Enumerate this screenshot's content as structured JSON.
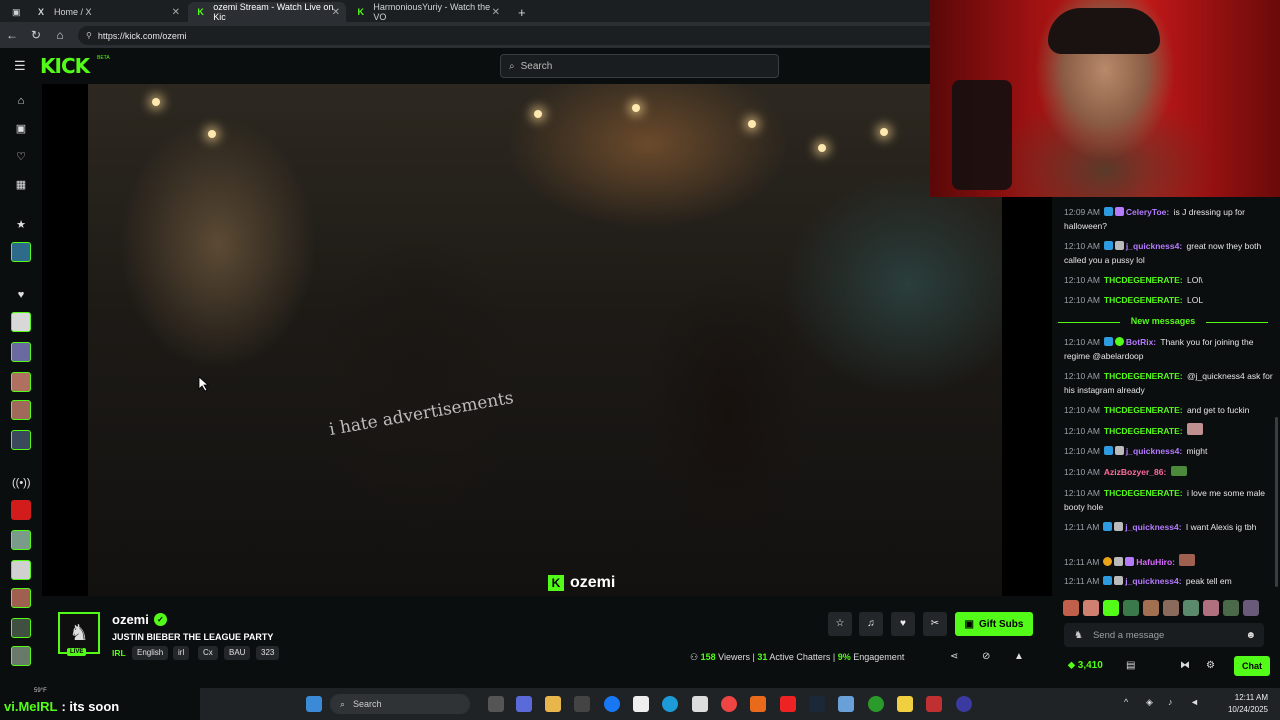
{
  "browser": {
    "tabs": [
      {
        "label": "Home / X",
        "icon": "x-logo-icon"
      },
      {
        "label": "ozemi Stream - Watch Live on Kic",
        "icon": "kick-logo-icon"
      },
      {
        "label": "HarmoniousYuriy - Watch the VO",
        "icon": "kick-logo-icon"
      }
    ],
    "new_tab": "+",
    "url": "https://kick.com/ozemi"
  },
  "header": {
    "logo": "KICK",
    "beta": "BETA",
    "search_placeholder": "Search"
  },
  "video": {
    "watermark": "ozemi",
    "shirt_text": "i hate advertisements"
  },
  "chat": {
    "messages": [
      {
        "time": "12:09 AM",
        "user": "CeleryToe:",
        "text": "is J dressing up for halloween?",
        "color": "#b57bff"
      },
      {
        "time": "12:10 AM",
        "user": "j_quickness4:",
        "text": "great now they both called you a pussy lol",
        "color": "#b57bff"
      },
      {
        "time": "12:10 AM",
        "user": "THCDEGENERATE:",
        "text": "LOl\\",
        "color": "#53fc18"
      },
      {
        "time": "12:10 AM",
        "user": "THCDEGENERATE:",
        "text": "LOL",
        "color": "#53fc18"
      },
      {
        "time": "12:10 AM",
        "user": "BotRix:",
        "text": "Thank you for joining the regime @abelardoop",
        "color": "#b57bff"
      },
      {
        "time": "12:10 AM",
        "user": "THCDEGENERATE:",
        "text": "@j_quickness4 ask for his instagram already",
        "color": "#53fc18"
      },
      {
        "time": "12:10 AM",
        "user": "THCDEGENERATE:",
        "text": "and get to fuckin",
        "color": "#53fc18"
      },
      {
        "time": "12:10 AM",
        "user": "THCDEGENERATE:",
        "text": "",
        "color": "#53fc18"
      },
      {
        "time": "12:10 AM",
        "user": "j_quickness4:",
        "text": "might",
        "color": "#b57bff"
      },
      {
        "time": "12:10 AM",
        "user": "AzizBozyer_86:",
        "text": "",
        "color": "#ff6b9a"
      },
      {
        "time": "12:10 AM",
        "user": "THCDEGENERATE:",
        "text": "i love me some male booty hole",
        "color": "#53fc18"
      },
      {
        "time": "12:11 AM",
        "user": "j_quickness4:",
        "text": "I want Alexis ig tbh",
        "color": "#b57bff"
      },
      {
        "time": "12:11 AM",
        "user": "HafuHiro:",
        "text": "",
        "color": "#d86bff"
      },
      {
        "time": "12:11 AM",
        "user": "j_quickness4:",
        "text": "peak tell em",
        "color": "#b57bff"
      }
    ],
    "new_messages_label": "New messages",
    "input_placeholder": "Send a message",
    "points": "3,410",
    "chat_button": "Chat"
  },
  "stream": {
    "streamer": "ozemi",
    "live_label": "LIVE",
    "title": "JUSTIN BIEBER THE LEAGUE PARTY",
    "category": "IRL",
    "tags": [
      "English",
      "irl",
      "Cx",
      "BAU",
      "323"
    ],
    "gift_subs": "Gift Subs",
    "viewers": "158",
    "viewers_label": "Viewers",
    "chatters": "31",
    "chatters_label": "Active Chatters",
    "engagement": "9%",
    "engagement_label": "Engagement"
  },
  "overlay": {
    "highlight": "vi.MeIRL",
    "text": ": its soon"
  },
  "taskbar": {
    "weather": "59°F",
    "search": "Search",
    "time": "12:11 AM",
    "date": "10/24/2025"
  },
  "colors": {
    "kick_green": "#53fc18",
    "background": "#0b0e0f"
  }
}
